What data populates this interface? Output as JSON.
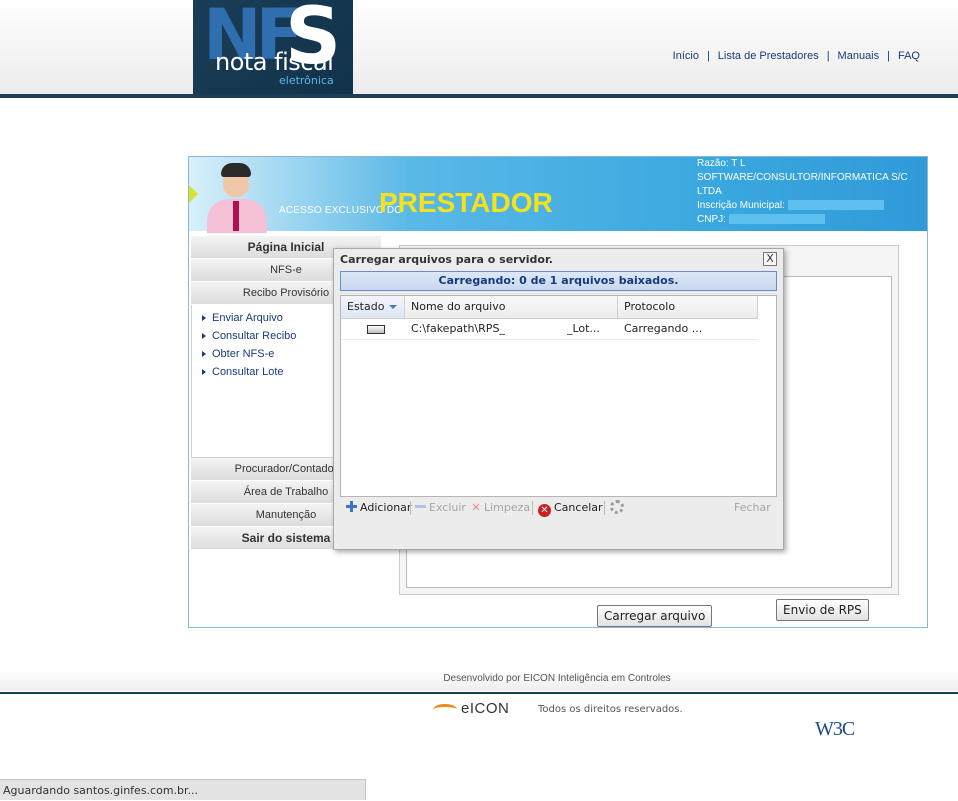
{
  "logo": {
    "nf": "NF",
    "s": "S",
    "nota": "nota fiscal",
    "sub": "eletrônica"
  },
  "topnav": {
    "items": [
      "Início",
      "Lista de Prestadores",
      "Manuais",
      "FAQ"
    ],
    "separator": "|"
  },
  "banner": {
    "acesso": "ACESSO EXCLUSIVO DO",
    "prestador": "PRESTADOR",
    "razao_label": "Razão: T L",
    "razao_value": "SOFTWARE/CONSULTOR/INFORMATICA S/C LTDA",
    "inscricao_label": "Inscrição Municipal:",
    "cnpj_label": "CNPJ:"
  },
  "sidebar": {
    "pagina_inicial": "Página Inicial",
    "nfse": "NFS-e",
    "recibo": "Recibo Provisório",
    "sub_items": [
      "Enviar Arquivo",
      "Consultar Recibo",
      "Obter NFS-e",
      "Consultar Lote"
    ],
    "procurador": "Procurador/Contador",
    "area": "Área de Trabalho",
    "manutencao": "Manutenção",
    "sair": "Sair do sistema"
  },
  "buttons": {
    "carregar": "Carregar arquivo",
    "envio": "Envio de RPS"
  },
  "dialog": {
    "title": "Carregar arquivos para o servidor.",
    "close": "X",
    "status": "Carregando: 0 de 1 arquivos baixados.",
    "columns": [
      "Estado",
      "Nome do arquivo",
      "Protocolo"
    ],
    "rows": [
      {
        "estado_progress": 0,
        "nome": "C:\\fakepath\\RPS_",
        "nome_suffix": "_Lot...",
        "protocolo": "Carregando ..."
      }
    ],
    "toolbar": {
      "adicionar": "Adicionar",
      "excluir": "Excluir",
      "limpeza": "Limpeza",
      "cancelar": "Cancelar",
      "fechar": "Fechar"
    }
  },
  "footer": {
    "desenvolvido": "Desenvolvido por EICON Inteligência em Controles",
    "eicon": "eICON",
    "rights": "Todos os direitos reservados.",
    "w3c": "W3C"
  },
  "statusbar": "Aguardando santos.ginfes.com.br...",
  "colors": {
    "navy": "#1d3f55",
    "banner_blue": "#3aa8e0",
    "prestador_yellow": "#f3e21c",
    "link": "#1a3a7a",
    "cancel_red": "#cc1f1f"
  }
}
